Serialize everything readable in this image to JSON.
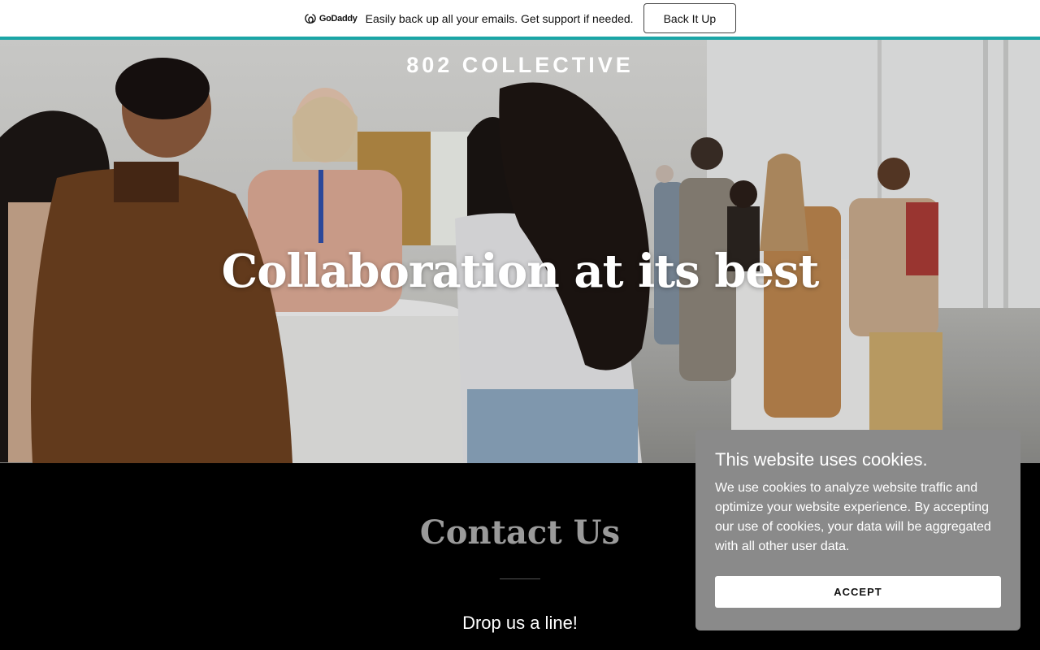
{
  "promo": {
    "logo_text": "GoDaddy",
    "message": "Easily back up all your emails. Get support if needed.",
    "button_label": "Back It Up",
    "accent_color": "#1ba5a6"
  },
  "hero": {
    "brand": "802 COLLECTIVE",
    "headline": "Collaboration at its best"
  },
  "contact": {
    "title": "Contact Us",
    "subtitle": "Drop us a line!"
  },
  "cookie_banner": {
    "title": "This website uses cookies.",
    "body": "We use cookies to analyze website traffic and optimize your website experience. By accepting our use of cookies, your data will be aggregated with all other user data.",
    "accept_label": "ACCEPT"
  }
}
